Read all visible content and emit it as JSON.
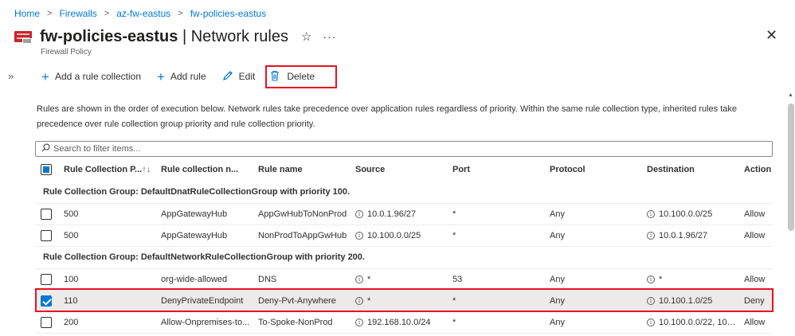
{
  "breadcrumb": [
    "Home",
    "Firewalls",
    "az-fw-eastus",
    "fw-policies-eastus"
  ],
  "header": {
    "title_bold": "fw-policies-eastus",
    "title_rest": " | Network rules",
    "subtitle": "Firewall Policy",
    "star_icon": "☆",
    "more_icon": "···",
    "close_icon": "✕",
    "expand_icon": "»"
  },
  "toolbar": {
    "add_collection_label": "Add a rule collection",
    "add_rule_label": "Add rule",
    "edit_label": "Edit",
    "delete_label": "Delete"
  },
  "description": "Rules are shown in the order of execution below. Network rules take precedence over application rules regardless of priority. Within the same rule collection type, inherited rules take precedence over rule collection group priority and rule collection priority.",
  "filter": {
    "placeholder": "Search to filter items..."
  },
  "table": {
    "columns": [
      "Rule Collection P...",
      "Rule collection n...",
      "Rule name",
      "Source",
      "Port",
      "Protocol",
      "Destination",
      "Action"
    ],
    "groups": [
      {
        "label": "Rule Collection Group: DefaultDnatRuleCollectionGroup with priority 100.",
        "rows": [
          {
            "priority": "500",
            "collection": "AppGatewayHub",
            "rule": "AppGwHubToNonProd",
            "source": "10.0.1.96/27",
            "port": "*",
            "protocol": "Any",
            "destination": "10.100.0.0/25",
            "action": "Allow",
            "selected": false
          },
          {
            "priority": "500",
            "collection": "AppGatewayHub",
            "rule": "NonProdToAppGwHub",
            "source": "10.100.0.0/25",
            "port": "*",
            "protocol": "Any",
            "destination": "10.0.1.96/27",
            "action": "Allow",
            "selected": false
          }
        ]
      },
      {
        "label": "Rule Collection Group: DefaultNetworkRuleCollectionGroup with priority 200.",
        "rows": [
          {
            "priority": "100",
            "collection": "org-wide-allowed",
            "rule": "DNS",
            "source": "*",
            "port": "53",
            "protocol": "Any",
            "destination": "*",
            "action": "Allow",
            "selected": false
          },
          {
            "priority": "110",
            "collection": "DenyPrivateEndpoint",
            "rule": "Deny-Pvt-Anywhere",
            "source": "*",
            "port": "*",
            "protocol": "Any",
            "destination": "10.100.1.0/25",
            "action": "Deny",
            "selected": true
          },
          {
            "priority": "200",
            "collection": "Allow-Onpremises-to...",
            "rule": "To-Spoke-NonProd",
            "source": "192.168.10.0/24",
            "port": "*",
            "protocol": "Any",
            "destination": "10.100.0.0/22, 10....",
            "action": "Allow",
            "selected": false
          }
        ]
      }
    ]
  },
  "colors": {
    "accent": "#0078d4",
    "highlight_border": "#e81123",
    "selected_row": "#edebe9"
  }
}
